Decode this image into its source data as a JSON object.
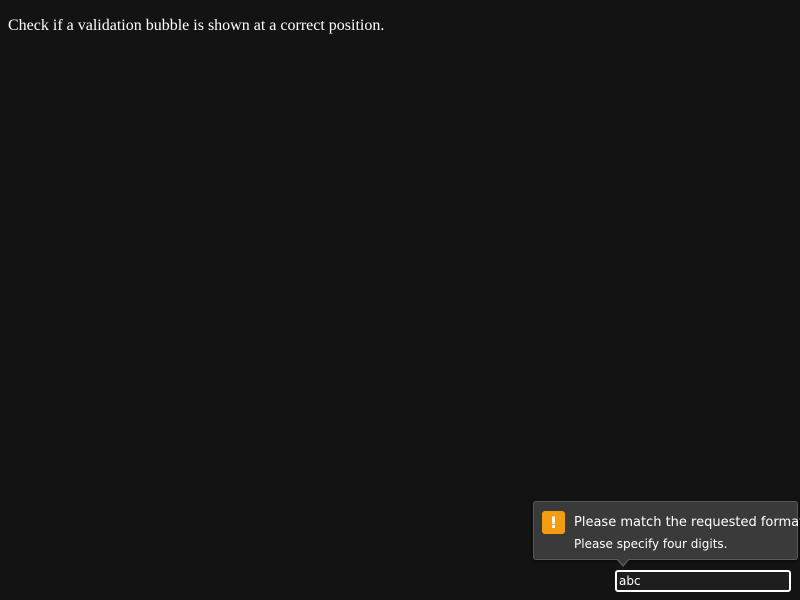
{
  "page": {
    "instruction": "Check if a validation bubble is shown at a correct position."
  },
  "validation_bubble": {
    "icon": "warning-icon",
    "icon_glyph": "!",
    "icon_color": "#f39c12",
    "heading": "Please match the requested format.",
    "message": "Please specify four digits."
  },
  "input": {
    "value": "abc"
  }
}
